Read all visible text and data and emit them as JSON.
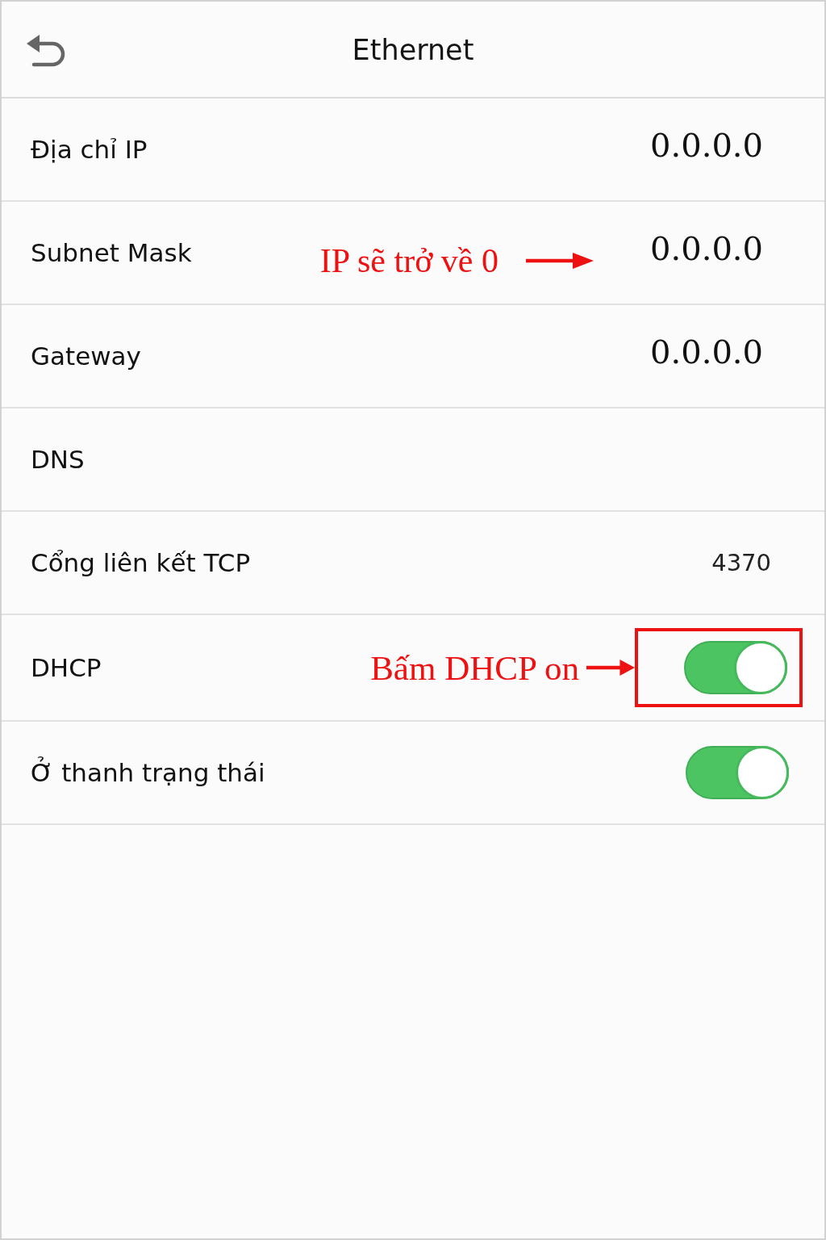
{
  "header": {
    "title": "Ethernet"
  },
  "rows": [
    {
      "kind": "address",
      "label": "Địa chỉ IP",
      "value": "0.0.0.0",
      "highlighted": false
    },
    {
      "kind": "address",
      "label": "Subnet Mask",
      "value": "0.0.0.0",
      "note": "IP sẽ trở về 0",
      "highlighted": false
    },
    {
      "kind": "address",
      "label": "Gateway",
      "value": "0.0.0.0",
      "highlighted": false
    },
    {
      "kind": "address",
      "label": "DNS",
      "highlighted": false
    },
    {
      "kind": "port",
      "label": "Cổng liên kết TCP",
      "value": "4370",
      "highlighted": false
    },
    {
      "kind": "toggle",
      "label": "DHCP",
      "on": true,
      "note": "Bấm DHCP on",
      "highlighted": true
    },
    {
      "kind": "toggle",
      "label": "Ở thanh trạng thái",
      "on": true,
      "highlighted": false
    }
  ]
}
